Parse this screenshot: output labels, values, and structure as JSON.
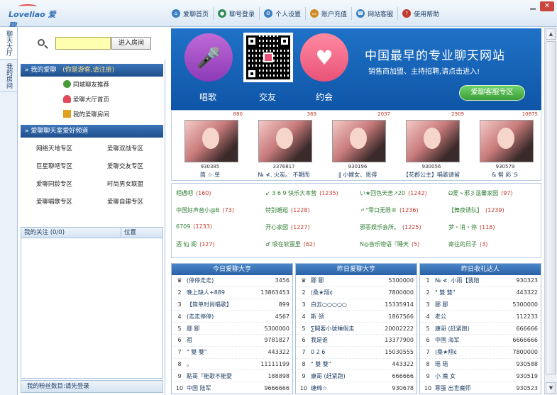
{
  "app": {
    "logo": "Loveliao 爱聊",
    "window": {
      "minimize": "▁",
      "close": "✕"
    }
  },
  "nav": [
    {
      "label": "爱聊首页",
      "icon": "home-icon",
      "color": "#3c7fc4"
    },
    {
      "label": "聊号登录",
      "icon": "user-icon",
      "color": "#2f8f5b"
    },
    {
      "label": "个人设置",
      "icon": "gear-icon",
      "color": "#3c7fc4"
    },
    {
      "label": "账户充值",
      "icon": "card-icon",
      "color": "#d08a21"
    },
    {
      "label": "网站客服",
      "icon": "service-icon",
      "color": "#3c7fc4"
    },
    {
      "label": "使用帮助",
      "icon": "help-icon",
      "color": "#c0392b"
    }
  ],
  "vtabs": [
    "聊天大厅",
    "我的房间"
  ],
  "left": {
    "enter_button": "进入房间",
    "my_love": {
      "title": "我的爱聊",
      "hint": "(你是游客,请注册)",
      "items": [
        "同城聊友推荐",
        "爱聊大厅首页",
        "我的爱聊房间"
      ]
    },
    "channels_title": "爱聊聊天室爱好频道",
    "channels": [
      "网络天地专区",
      "爱聊双战专区",
      "巨星聊吧专区",
      "爱聊交友专区",
      "爱聊同龄专区",
      "时尚男女联盟",
      "爱聊唱歌专区",
      "爱聊自建专区"
    ],
    "follow": {
      "label": "我的关注 (0/0)",
      "position": "位置"
    },
    "fans": "我的粉丝数目:请先登录"
  },
  "banner": {
    "title": "中国最早的专业聊天网站",
    "subtitle": "销售商加盟、主持招聘,请点击进入!",
    "labels": [
      "唱歌",
      "交友",
      "约会"
    ],
    "button": "爱聊客服专区"
  },
  "hosts": [
    {
      "count": "880",
      "id": "930385",
      "name": "简 ☆ 单"
    },
    {
      "count": "369",
      "id": "3376817",
      "name": "№ ≮. 火炭。 不期而"
    },
    {
      "count": "2037",
      "id": "930196",
      "name": "‖ 小嫁女、恩得"
    },
    {
      "count": "2909",
      "id": "930056",
      "name": "【花郡公主】唱歌请留"
    },
    {
      "count": "10875",
      "id": "930579",
      "name": "& 帮 彩 彡"
    }
  ],
  "rooms": [
    {
      "name": "相遇吧",
      "count": "(160)"
    },
    {
      "name": "↙ 3 6 9 快乐大本营",
      "count": "(1235)"
    },
    {
      "name": "い★回色天舍↗20",
      "count": "(1242)"
    },
    {
      "name": "Ω爱ヽ邪彡温馨家园",
      "count": "(97)"
    },
    {
      "name": "中国好声音小@B",
      "count": "(73)"
    },
    {
      "name": "特别邂逅",
      "count": "(1228)"
    },
    {
      "name": "〃°零口无限®",
      "count": "(1236)"
    },
    {
      "name": "【舞夜诱队】",
      "count": "(1239)"
    },
    {
      "name": "6709",
      "count": "(1233)"
    },
    {
      "name": "开心家园",
      "count": "(1227)"
    },
    {
      "name": "邪恶娱乐会所。",
      "count": "(1225)"
    },
    {
      "name": "梦・消・停",
      "count": "(118)"
    },
    {
      "name": "酒 仙 阁",
      "count": "(127)"
    },
    {
      "name": "♂ 吸在软蛋里",
      "count": "(62)"
    },
    {
      "name": "N◎音乐物语『睡天",
      "count": "(5)"
    },
    {
      "name": "寄往的日子",
      "count": "(3)"
    }
  ],
  "boards": [
    {
      "title": "今日爱聊大亨",
      "rows": [
        {
          "rank": "♛",
          "name": "(停停走走)",
          "value": "3456"
        },
        {
          "rank": "2",
          "name": "晚上缺人+889",
          "value": "13863453"
        },
        {
          "rank": "3",
          "name": "【简单时尚唱歌】",
          "value": "899"
        },
        {
          "rank": "4",
          "name": "(走走停停)",
          "value": "4567"
        },
        {
          "rank": "5",
          "name": "鄒 鄒",
          "value": "5300000"
        },
        {
          "rank": "6",
          "name": "祖",
          "value": "9781827"
        },
        {
          "rank": "7",
          "name": "\" 雙 雙\"",
          "value": "443322"
        },
        {
          "rank": "8",
          "name": "。",
          "value": "11111199"
        },
        {
          "rank": "9",
          "name": "點哥『能歌不能愛",
          "value": "188898"
        },
        {
          "rank": "10",
          "name": "中国 陆军",
          "value": "9666666"
        }
      ]
    },
    {
      "title": "昨日爱聊大亨",
      "rows": [
        {
          "rank": "♛",
          "name": "鄒 鄒",
          "value": "5300000"
        },
        {
          "rank": "2",
          "name": "(桑★翔¢",
          "value": "7800000"
        },
        {
          "rank": "3",
          "name": "白云○○○○○",
          "value": "15335914"
        },
        {
          "rank": "4",
          "name": "斯 领",
          "value": "1867566"
        },
        {
          "rank": "5",
          "name": "∑開著小號睡假走",
          "value": "20002222"
        },
        {
          "rank": "6",
          "name": "我是谁",
          "value": "13377900"
        },
        {
          "rank": "7",
          "name": "0 2 6",
          "value": "15030555"
        },
        {
          "rank": "8",
          "name": "\" 雙 雙\"",
          "value": "443322"
        },
        {
          "rank": "9",
          "name": "康哥 (赶紧跑)",
          "value": "666666"
        },
        {
          "rank": "10",
          "name": "缠绵☆",
          "value": "930678"
        }
      ]
    },
    {
      "title": "昨日收礼达人",
      "rows": [
        {
          "rank": "1",
          "name": "№ ≮. 小雨【我陪",
          "value": "930323"
        },
        {
          "rank": "2",
          "name": "\" 雙 雙\"",
          "value": "443322"
        },
        {
          "rank": "3",
          "name": "鄒 鄒",
          "value": "5300000"
        },
        {
          "rank": "4",
          "name": "老公",
          "value": "112233"
        },
        {
          "rank": "5",
          "name": "康哥 (赶紧跑)",
          "value": "666666"
        },
        {
          "rank": "6",
          "name": "中国 海军",
          "value": "6666666"
        },
        {
          "rank": "7",
          "name": "(桑★翔¢",
          "value": "7800000"
        },
        {
          "rank": "8",
          "name": "瑶 瑶",
          "value": "930588"
        },
        {
          "rank": "9",
          "name": "小 魔 女",
          "value": "930519"
        },
        {
          "rank": "10",
          "name": "寒蛋 出世魔师",
          "value": "930523"
        }
      ]
    }
  ]
}
